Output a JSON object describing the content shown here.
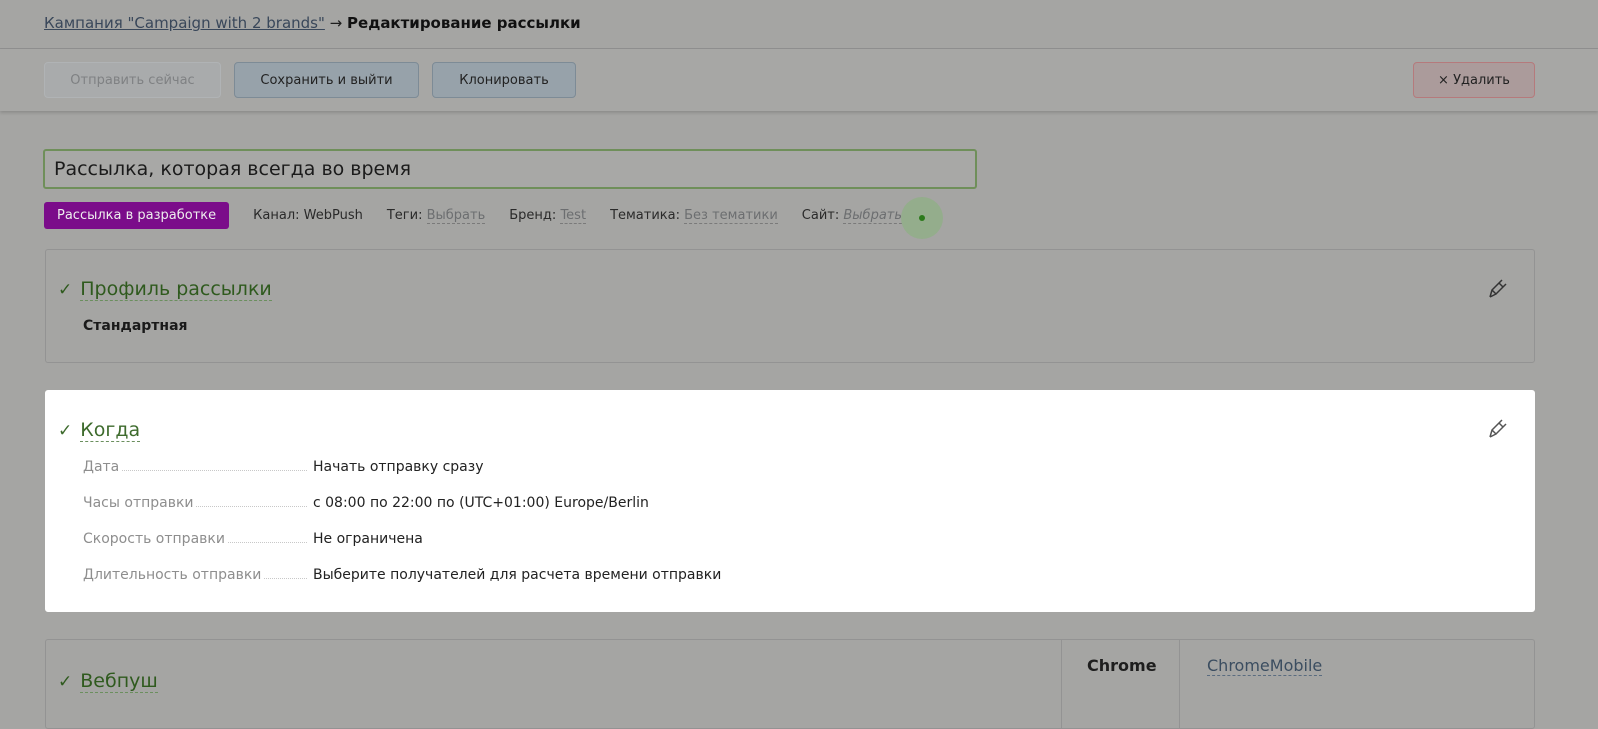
{
  "breadcrumb": {
    "campaign_link": "Кампания \"Campaign with 2 brands\"",
    "arrow": "→",
    "current": "Редактирование рассылки"
  },
  "toolbar": {
    "send_now": "Отправить сейчас",
    "save_exit": "Сохранить и выйти",
    "clone": "Клонировать",
    "delete": "× Удалить"
  },
  "mailing": {
    "title": "Рассылка, которая всегда во время",
    "status_badge": "Рассылка в разработке",
    "status_color": "#8a0f9a",
    "channel_label": "Канал: WebPush",
    "tags_label": "Теги:",
    "tags_value": "Выбрать",
    "brand_label": "Бренд:",
    "brand_value": "Test",
    "topic_label": "Тематика:",
    "topic_value": "Без тематики",
    "site_label": "Сайт:",
    "site_value": "Выбрать"
  },
  "profile": {
    "title": "Профиль рассылки",
    "value": "Стандартная",
    "check_icon": "checkmark",
    "edit_icon": "pencil"
  },
  "when": {
    "title": "Когда",
    "rows": [
      {
        "key": "Дата",
        "value": "Начать отправку сразу"
      },
      {
        "key": "Часы отправки",
        "value": "с 08:00 по 22:00 по (UTC+01:00) Europe/Berlin"
      },
      {
        "key": "Скорость отправки",
        "value": "Не ограничена"
      },
      {
        "key": "Длительность отправки",
        "value": "Выберите получателей для расчета времени отправки"
      }
    ]
  },
  "webpush": {
    "title": "Вебпуш",
    "browser": "Chrome",
    "browser_variant": "ChromeMobile"
  }
}
